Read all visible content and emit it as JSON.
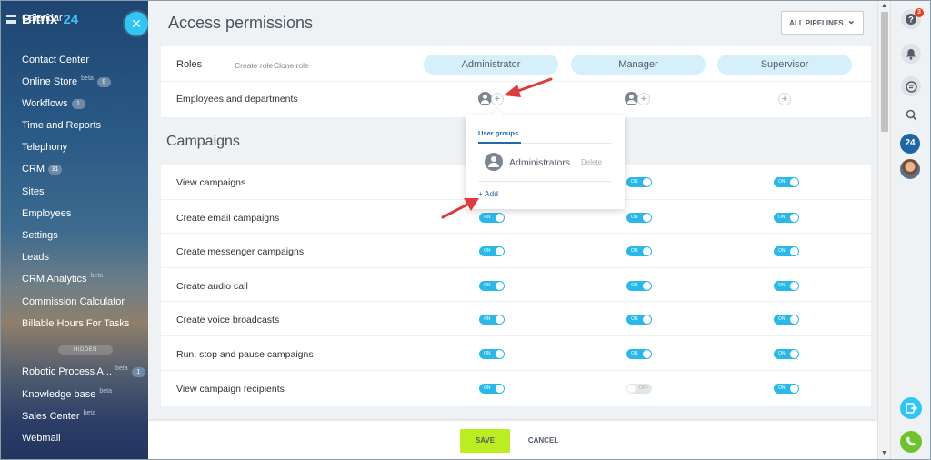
{
  "sidebar": {
    "brand": "Bitrix",
    "brand_num": "24",
    "close_glyph": "✕",
    "items": [
      {
        "label": "Calendar"
      },
      {
        "label": "Contact Center"
      },
      {
        "label": "Online Store",
        "sup": "beta",
        "count": "9"
      },
      {
        "label": "Workflows",
        "count": "1"
      },
      {
        "label": "Time and Reports"
      },
      {
        "label": "Telephony"
      },
      {
        "label": "CRM",
        "count": "31"
      },
      {
        "label": "Sites"
      },
      {
        "label": "Employees"
      },
      {
        "label": "Settings"
      },
      {
        "label": "Leads"
      },
      {
        "label": "CRM Analytics",
        "sup": "beta"
      },
      {
        "label": "Commission Calculator"
      },
      {
        "label": "Billable Hours For Tasks"
      },
      {
        "label": "Robotic Process A...",
        "sup": "beta",
        "count": "1"
      },
      {
        "label": "Knowledge base",
        "sup": "beta"
      },
      {
        "label": "Sales Center",
        "sup": "beta"
      },
      {
        "label": "Webmail"
      }
    ],
    "hidden_label": "HIDDEN"
  },
  "header": {
    "title": "Access permissions",
    "pipelines_button": "ALL PIPELINES",
    "chevron": "⌄"
  },
  "roles_card": {
    "roles_label": "Roles",
    "create_role": "Create role",
    "clone_role": "Clone role",
    "roles": [
      "Administrator",
      "Manager",
      "Supervisor"
    ],
    "employees_label": "Employees and departments",
    "plus_glyph": "+"
  },
  "campaigns": {
    "section_title": "Campaigns",
    "rows": [
      {
        "label": "View campaigns",
        "states": [
          "on",
          "on",
          "on"
        ]
      },
      {
        "label": "Create email campaigns",
        "states": [
          "on",
          "on",
          "on"
        ]
      },
      {
        "label": "Create messenger campaigns",
        "states": [
          "on",
          "on",
          "on"
        ]
      },
      {
        "label": "Create audio call",
        "states": [
          "on",
          "on",
          "on"
        ]
      },
      {
        "label": "Create voice broadcasts",
        "states": [
          "on",
          "on",
          "on"
        ]
      },
      {
        "label": "Run, stop and pause campaigns",
        "states": [
          "on",
          "on",
          "on"
        ]
      },
      {
        "label": "View campaign recipients",
        "states": [
          "on",
          "off",
          "on"
        ]
      }
    ],
    "on_text": "ON",
    "off_text": "OFF"
  },
  "popup": {
    "tab": "User groups",
    "group_name": "Administrators",
    "delete_label": "Delete",
    "add_label": "+ Add"
  },
  "footer": {
    "save": "SAVE",
    "cancel": "CANCEL"
  },
  "rail": {
    "help_badge": "3",
    "b24_label": "24"
  },
  "colors": {
    "accent": "#2fc6f6",
    "toggle_on": "#29b8ea",
    "save": "#bbed21",
    "annotation_arrow": "#e03b3b"
  }
}
